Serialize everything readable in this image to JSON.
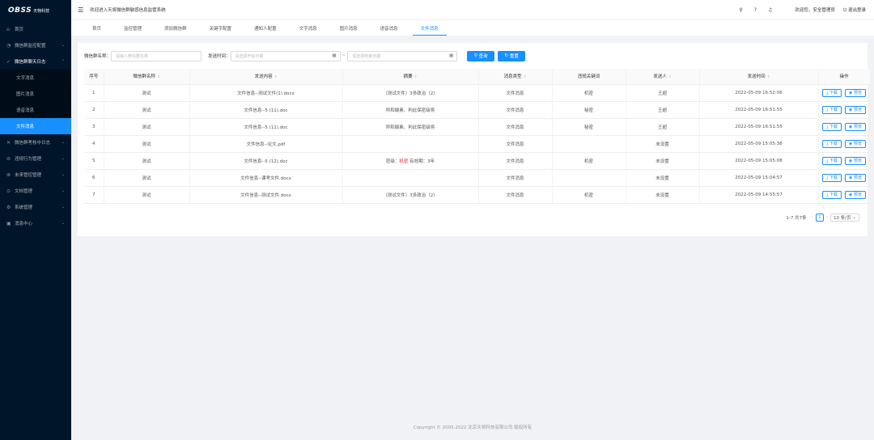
{
  "logo": {
    "name": "天物科技",
    "brand": "OBSS"
  },
  "header": {
    "welcome": "欢迎进入天将微信群敏感信息监管系统",
    "user_greeting": "欢迎您，安全管理员",
    "logout": "退出登录"
  },
  "sidebar": {
    "items": [
      {
        "label": "首页",
        "icon": "home-icon"
      },
      {
        "label": "微信群监控配置",
        "icon": "settings-icon",
        "arrow": "⌄"
      },
      {
        "label": "微信群聊天日志",
        "icon": "check-icon",
        "arrow": "⌃",
        "open": true
      },
      {
        "label": "微信群考核中日志",
        "icon": "close-icon",
        "arrow": "⌄"
      },
      {
        "label": "违规行为管理",
        "icon": "warning-icon",
        "arrow": "⌄"
      },
      {
        "label": "未来管控管理",
        "icon": "control-icon",
        "arrow": "⌄"
      },
      {
        "label": "文档管理",
        "icon": "doc-icon",
        "arrow": "⌄"
      },
      {
        "label": "系统管理",
        "icon": "gear-icon",
        "arrow": "⌄"
      },
      {
        "label": "消息中心",
        "icon": "message-icon",
        "arrow": "⌄"
      }
    ],
    "sub_items": [
      {
        "label": "文字消息"
      },
      {
        "label": "图片消息"
      },
      {
        "label": "语音消息"
      },
      {
        "label": "文件消息",
        "active": true
      }
    ]
  },
  "tabs": [
    {
      "label": "首页"
    },
    {
      "label": "监控管理"
    },
    {
      "label": "添加微信群"
    },
    {
      "label": "关键字配置"
    },
    {
      "label": "通知人配置"
    },
    {
      "label": "文字消息"
    },
    {
      "label": "图片消息"
    },
    {
      "label": "语音消息"
    },
    {
      "label": "文件消息",
      "active": true
    }
  ],
  "filters": {
    "group_name_label": "微信群名称：",
    "group_name_placeholder": "请输入微信群名称",
    "time_label": "发送时间：",
    "start_placeholder": "请选择开始日期",
    "separator": "~",
    "end_placeholder": "请选择结束日期",
    "search_button": "查询",
    "reset_button": "重置"
  },
  "table": {
    "columns": [
      "序号",
      "微信群名称",
      "发送内容",
      "摘要",
      "消息类型",
      "违规关键词",
      "发送人",
      "发送时间",
      "操作"
    ],
    "sortable": [
      false,
      true,
      true,
      true,
      true,
      false,
      true,
      true,
      false
    ],
    "rows": [
      {
        "no": "1",
        "group": "测试",
        "content": "文件信息--测试文件(1).docx",
        "summary": "（测试文件）3多政治（2）",
        "summary_kw": "",
        "summary_post": "",
        "type": "文件消息",
        "keyword": "机密",
        "sender": "王超",
        "time": "2022-05-09 16:52:06"
      },
      {
        "no": "2",
        "group": "测试",
        "content": "文件信息--5 (11).doc",
        "summary": "异和摄素、判此保密级将",
        "summary_kw": "",
        "summary_post": "",
        "type": "文件消息",
        "keyword": "秘密",
        "sender": "王超",
        "time": "2022-05-09 16:51:55"
      },
      {
        "no": "3",
        "group": "测试",
        "content": "文件信息--5 (11).doc",
        "summary": "异和摄素、判此保密级将",
        "summary_kw": "",
        "summary_post": "",
        "type": "文件消息",
        "keyword": "秘密",
        "sender": "王超",
        "time": "2022-05-09 16:51:55"
      },
      {
        "no": "4",
        "group": "测试",
        "content": "文件信息--论文.pdf",
        "summary": "",
        "summary_kw": "",
        "summary_post": "",
        "type": "文件消息",
        "keyword": "",
        "sender": "未设置",
        "time": "2022-05-09 15:05:38"
      },
      {
        "no": "5",
        "group": "测试",
        "content": "文件信息--5 (12).doc",
        "summary": "密级：",
        "summary_kw": "机密",
        "summary_post": " 有效期：3年",
        "type": "文件消息",
        "keyword": "机密",
        "sender": "未设置",
        "time": "2022-05-09 15:05:08"
      },
      {
        "no": "6",
        "group": "测试",
        "content": "文件信息--课考文件.docx",
        "summary": "",
        "summary_kw": "",
        "summary_post": "",
        "type": "文件消息",
        "keyword": "",
        "sender": "未设置",
        "time": "2022-05-09 15:04:57"
      },
      {
        "no": "7",
        "group": "测试",
        "content": "文件信息--测试文件.docx",
        "summary": "（测试文件）3多政治（2）",
        "summary_kw": "",
        "summary_post": "",
        "type": "文件消息",
        "keyword": "机密",
        "sender": "未设置",
        "time": "2022-05-09 14:55:57"
      }
    ],
    "download_label": "下载",
    "preview_label": "预览"
  },
  "pagination": {
    "summary": "1-7 共7条",
    "prev": "‹",
    "page": "1",
    "next": "›",
    "page_size": "10 条/页"
  },
  "footer": "Copyright © 2005-2022 北京天将科技有限公司 版权所有",
  "colors": {
    "primary": "#1890ff",
    "sidebar": "#001529",
    "keyword": "#f5222d"
  }
}
